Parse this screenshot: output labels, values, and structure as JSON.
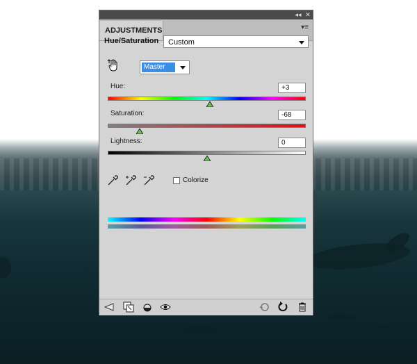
{
  "panel": {
    "title_tab": "ADJUSTMENTS",
    "adjustment_label": "Hue/Saturation",
    "preset_value": "Custom",
    "channel_value": "Master",
    "colorize_label": "Colorize"
  },
  "sliders": {
    "hue_label": "Hue:",
    "hue_value": "+3",
    "saturation_label": "Saturation:",
    "saturation_value": "-68",
    "lightness_label": "Lightness:",
    "lightness_value": "0"
  },
  "colors": {
    "panel_bg": "#d4d4d4",
    "titlebar": "#4b4b4b",
    "select_highlight": "#3a8ee6"
  },
  "icons": {
    "titlebar": [
      "collapse-icon",
      "close-icon"
    ],
    "tools": [
      "hand-adjust-icon",
      "eyedropper-icon",
      "eyedropper-plus-icon",
      "eyedropper-minus-icon"
    ],
    "bottom_left": [
      "back-arrow-icon",
      "clip-to-layer-icon",
      "visibility-toggle-icon",
      "eye-icon"
    ],
    "bottom_right": [
      "view-previous-icon",
      "reset-icon",
      "trash-icon"
    ]
  }
}
